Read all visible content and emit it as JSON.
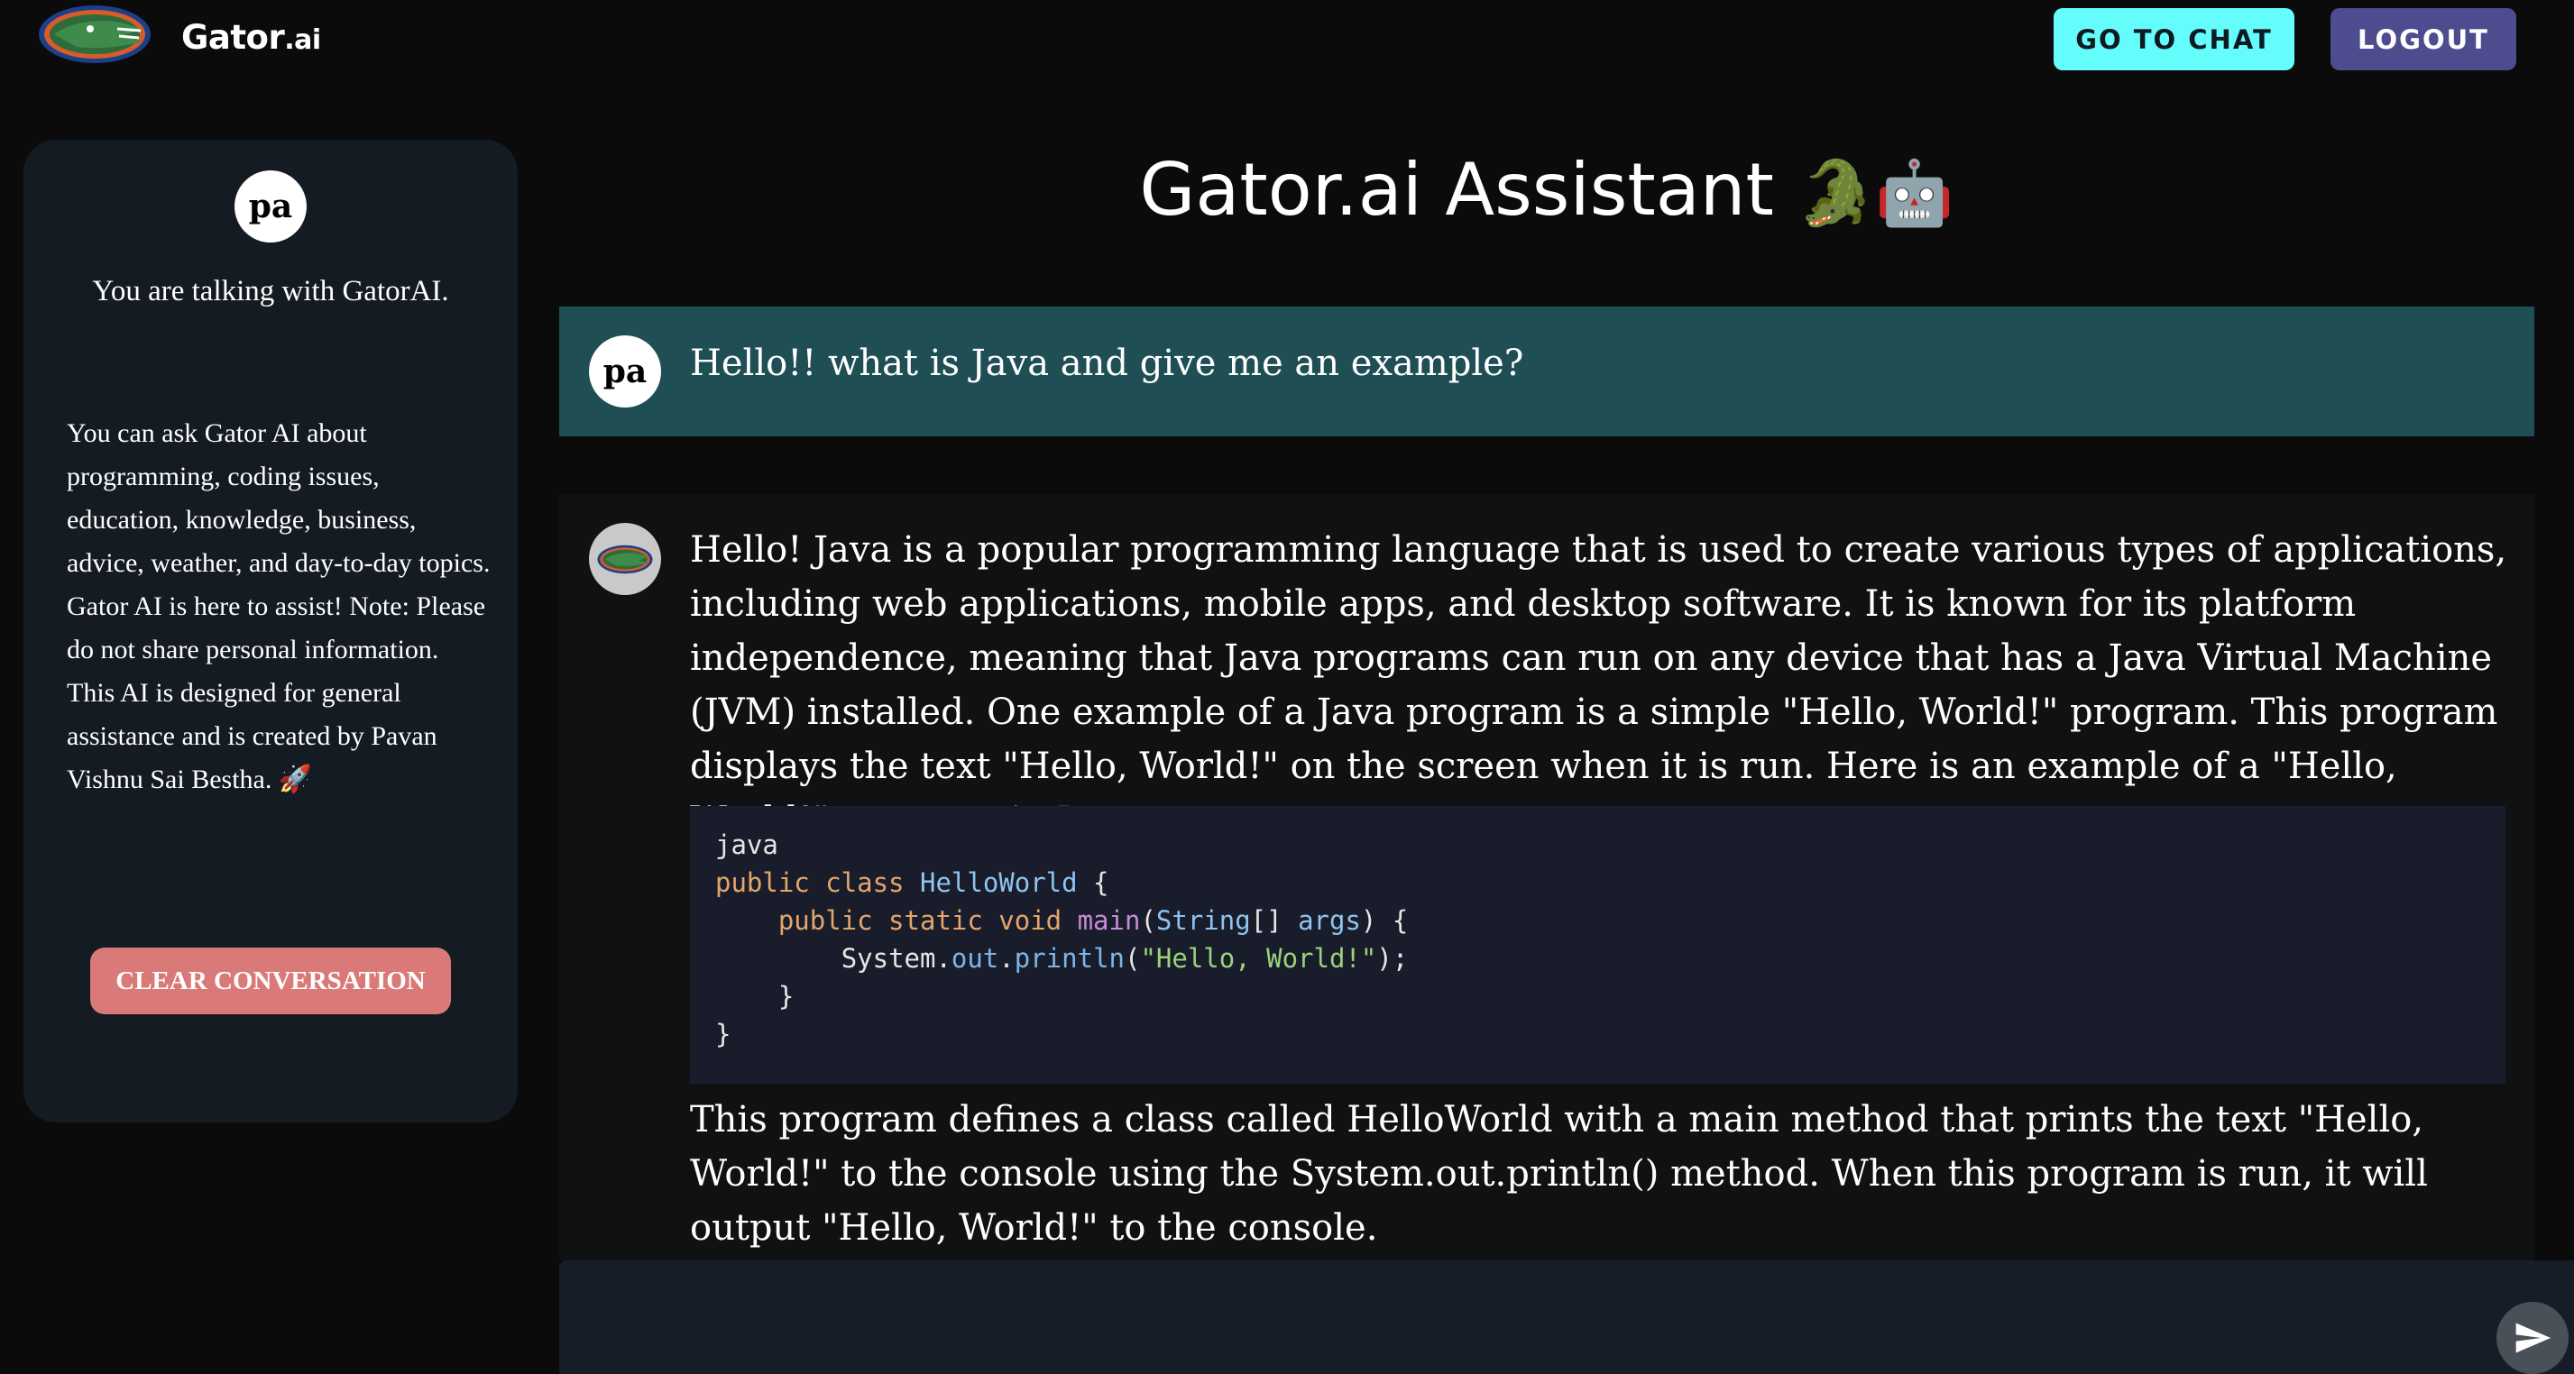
{
  "header": {
    "brand_main": "Gator",
    "brand_suffix": ".ai",
    "go_to_chat": "GO TO CHAT",
    "logout": "LOGOUT"
  },
  "sidebar": {
    "avatar_initials": "pa",
    "talking_with": "You are talking with GatorAI.",
    "info": "You can ask Gator AI about programming, coding issues, education, knowledge, business, advice, weather, and day-to-day topics. Gator AI is here to assist! Note: Please do not share personal information. This AI is designed for general assistance and is created by Pavan Vishnu Sai Bestha. 🚀",
    "clear_button": "CLEAR CONVERSATION"
  },
  "main": {
    "title": "Gator.ai Assistant",
    "title_emoji": "🐊🤖"
  },
  "conversation": {
    "user_initials": "pa",
    "user_message": "Hello!! what is Java and give me an example?",
    "bot_intro": "Hello! Java is a popular programming language that is used to create various types of applications, including web applications, mobile apps, and desktop software. It is known for its platform independence, meaning that Java programs can run on any device that has a Java Virtual Machine (JVM) installed. One example of a Java program is a simple \"Hello, World!\" program. This program displays the text \"Hello, World!\" on the screen when it is run. Here is an example of a \"Hello, World!\" program in Java:",
    "code": {
      "lang": "java",
      "line1_kw": "public class",
      "line1_cls": "HelloWorld",
      "line1_end": " {",
      "line2_kw": "public static void",
      "line2_fn": "main",
      "line2_open": "(",
      "line2_type": "String",
      "line2_arr": "[] ",
      "line2_arg": "args",
      "line2_end": ") {",
      "line3_obj": "System.",
      "line3_out": "out",
      "line3_dot": ".",
      "line3_fn": "println",
      "line3_open": "(",
      "line3_str": "\"Hello, World!\"",
      "line3_end": ");",
      "line4": "}",
      "line5": "}"
    },
    "bot_outro": "This program defines a class called HelloWorld with a main method that prints the text \"Hello, World!\" to the console using the System.out.println() method. When this program is run, it will output \"Hello, World!\" to the console."
  },
  "composer": {
    "placeholder": ""
  },
  "icons": {
    "logo": "gator-logo-icon",
    "bot_avatar": "gator-avatar-icon",
    "send": "send-icon"
  },
  "colors": {
    "accent_chat": "#64fdfb",
    "logout": "#4c4c8e",
    "clear": "#d97a78",
    "user_bubble": "#1f4e55"
  }
}
